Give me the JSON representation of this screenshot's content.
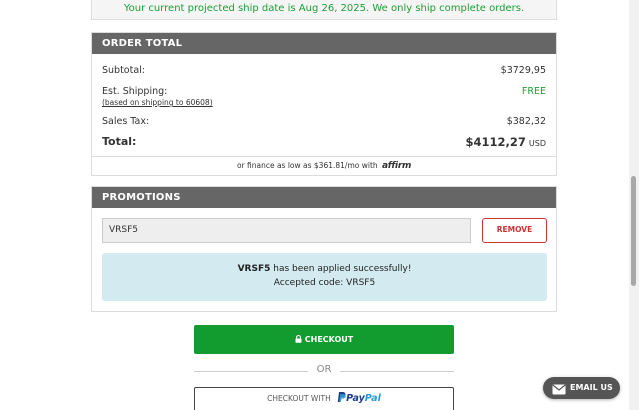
{
  "ship_notice": "Your current projected ship date is Aug 26, 2025. We only ship complete orders.",
  "order_total": {
    "header": "ORDER TOTAL",
    "subtotal_label": "Subtotal:",
    "subtotal_value": "$3729,95",
    "shipping_label": "Est. Shipping:",
    "shipping_sub": "(based on shipping to 60608)",
    "shipping_value": "FREE",
    "tax_label": "Sales Tax:",
    "tax_value": "$382,32",
    "total_label": "Total:",
    "total_value": "$4112,27",
    "currency": "USD",
    "finance_text": "or finance as low as $361.81/mo with",
    "finance_brand": "affirm"
  },
  "promotions": {
    "header": "PROMOTIONS",
    "code_value": "VRSF5",
    "remove_label": "REMOVE",
    "success_code": "VRSF5",
    "success_text": "has been applied successfully!",
    "accepted_text": "Accepted code: VRSF5"
  },
  "checkout": {
    "button_label": "CHECKOUT",
    "or_label": "OR",
    "paypal_prefix": "CHECKOUT WITH",
    "paypal_brand_1": "Pay",
    "paypal_brand_2": "Pal"
  },
  "email_us": "EMAIL US",
  "colors": {
    "accent_green": "#129b2f",
    "header_gray": "#666666",
    "remove_red": "#cc3333",
    "success_bg": "#d3ebf0"
  }
}
